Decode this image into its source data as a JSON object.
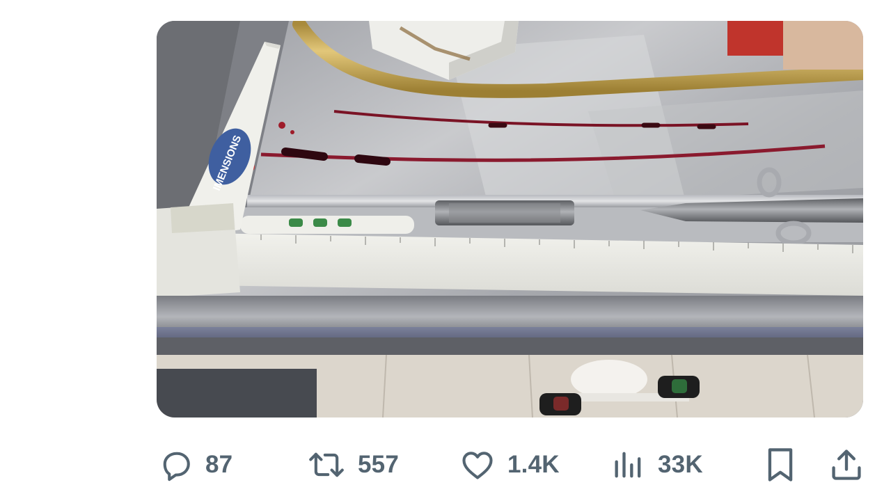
{
  "media": {
    "ruler_brand_text": "IMENSIONS"
  },
  "actions": {
    "reply": {
      "icon": "comment-icon",
      "count": "87"
    },
    "repost": {
      "icon": "repost-icon",
      "count": "557"
    },
    "like": {
      "icon": "heart-icon",
      "count": "1.4K"
    },
    "views": {
      "icon": "bar-chart-icon",
      "count": "33K"
    },
    "bookmark": {
      "icon": "bookmark-icon"
    },
    "share": {
      "icon": "share-icon"
    }
  },
  "colors": {
    "icon": "#536471",
    "background": "#ffffff"
  }
}
